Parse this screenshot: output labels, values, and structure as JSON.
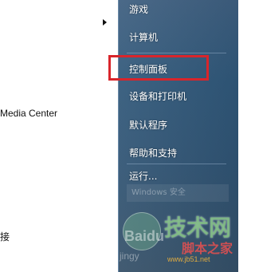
{
  "left_panel": {
    "items": [
      {
        "label": "Media Center"
      },
      {
        "label": "接"
      }
    ]
  },
  "right_panel": {
    "items": [
      {
        "label": "游戏"
      },
      {
        "label": "计算机"
      },
      {
        "label": "控制面板"
      },
      {
        "label": "设备和打印机"
      },
      {
        "label": "默认程序"
      },
      {
        "label": "帮助和支持"
      },
      {
        "label": "运行..."
      }
    ],
    "highlighted_item": "控制面板",
    "highlight_color": "#d9252b",
    "faint_item": "Windows 安全"
  },
  "watermark": {
    "big_text": "技术网",
    "baidu_text": "Baidu",
    "brand_text": "脚本之家",
    "url_left": "jingy",
    "url": "www.jb51.net"
  }
}
